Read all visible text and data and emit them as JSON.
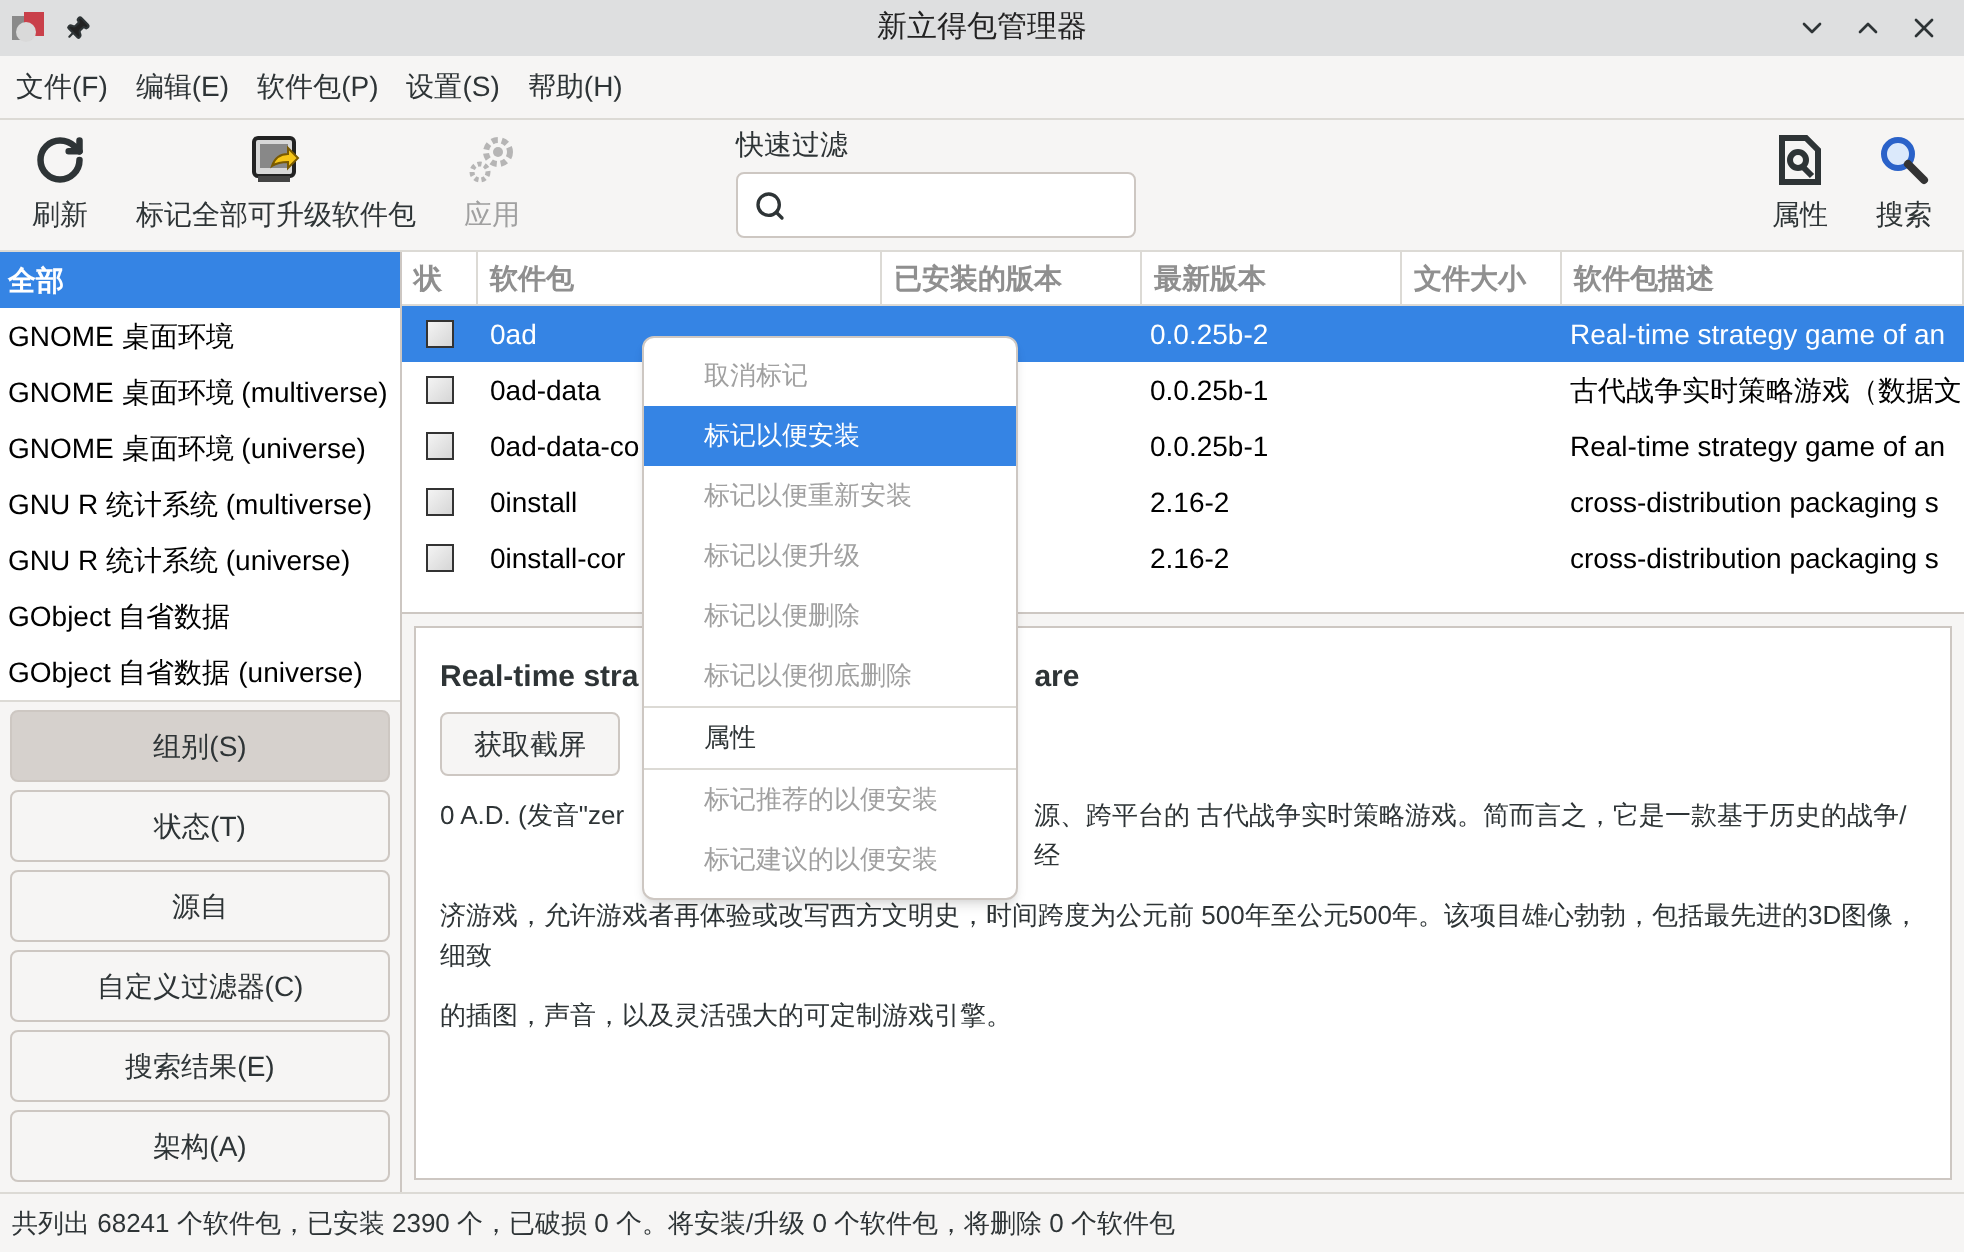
{
  "window": {
    "title": "新立得包管理器"
  },
  "menubar": [
    "文件(F)",
    "编辑(E)",
    "软件包(P)",
    "设置(S)",
    "帮助(H)"
  ],
  "toolbar": [
    {
      "kind": "refresh",
      "label": "刷新",
      "disabled": false
    },
    {
      "kind": "mark_all",
      "label": "标记全部可升级软件包",
      "disabled": false
    },
    {
      "kind": "apply",
      "label": "应用",
      "disabled": true
    }
  ],
  "quick_filter": {
    "label": "快速过滤"
  },
  "toolbar_right": [
    {
      "kind": "properties",
      "label": "属性"
    },
    {
      "kind": "search",
      "label": "搜索"
    }
  ],
  "sidebar": {
    "items": [
      {
        "label": "全部",
        "selected": true
      },
      {
        "label": "GNOME 桌面环境",
        "selected": false
      },
      {
        "label": "GNOME 桌面环境 (multiverse)",
        "selected": false
      },
      {
        "label": "GNOME 桌面环境 (universe)",
        "selected": false
      },
      {
        "label": "GNU R 统计系统 (multiverse)",
        "selected": false
      },
      {
        "label": "GNU R 统计系统 (universe)",
        "selected": false
      },
      {
        "label": "GObject 自省数据",
        "selected": false
      },
      {
        "label": "GObject 自省数据 (universe)",
        "selected": false
      }
    ],
    "buttons": [
      {
        "label": "组别(S)",
        "selected": true
      },
      {
        "label": "状态(T)",
        "selected": false
      },
      {
        "label": "源自",
        "selected": false
      },
      {
        "label": "自定义过滤器(C)",
        "selected": false
      },
      {
        "label": "搜索结果(E)",
        "selected": false
      },
      {
        "label": "架构(A)",
        "selected": false
      }
    ]
  },
  "table": {
    "columns": [
      "状",
      "软件包",
      "已安装的版本",
      "最新版本",
      "文件大小",
      "软件包描述"
    ],
    "rows": [
      {
        "checked": false,
        "selected": true,
        "name": "0ad",
        "latest": "0.0.25b-2",
        "description": "Real-time strategy game of an"
      },
      {
        "checked": false,
        "selected": false,
        "name": "0ad-data",
        "latest": "0.0.25b-1",
        "description": "古代战争实时策略游戏（数据文"
      },
      {
        "checked": false,
        "selected": false,
        "name": "0ad-data-co",
        "latest": "0.0.25b-1",
        "description": "Real-time strategy game of an"
      },
      {
        "checked": false,
        "selected": false,
        "name": "0install",
        "latest": "2.16-2",
        "description": "cross-distribution packaging s"
      },
      {
        "checked": false,
        "selected": false,
        "name": "0install-cor",
        "latest": "2.16-2",
        "description": "cross-distribution packaging s"
      }
    ]
  },
  "details": {
    "title_parts": [
      "Real-time stra",
      "are"
    ],
    "buttons": [
      "获取截屏"
    ],
    "paragraphs": [
      {
        "parts": [
          "0 A.D. (发音\"zer",
          "源、跨平台的 古代战争实时策略游戏。简而言之，它是一款基于历史的战争/经"
        ]
      },
      {
        "parts": [
          "济游戏，允许游戏者再体验或改写西方文明史，时间跨度为公元前 500年至公元500年。该项目雄心勃勃，包括最先进的3D图像，细致"
        ]
      },
      {
        "parts": [
          "的插图，声音，以及灵活强大的可定制游戏引擎。"
        ]
      }
    ]
  },
  "context_menu": [
    {
      "kind": "item",
      "label": "取消标记",
      "disabled": true,
      "selected": false
    },
    {
      "kind": "item",
      "label": "标记以便安装",
      "disabled": false,
      "selected": true
    },
    {
      "kind": "item",
      "label": "标记以便重新安装",
      "disabled": true,
      "selected": false
    },
    {
      "kind": "item",
      "label": "标记以便升级",
      "disabled": true,
      "selected": false
    },
    {
      "kind": "item",
      "label": "标记以便删除",
      "disabled": true,
      "selected": false
    },
    {
      "kind": "item",
      "label": "标记以便彻底删除",
      "disabled": true,
      "selected": false
    },
    {
      "kind": "separator"
    },
    {
      "kind": "item",
      "label": "属性",
      "disabled": false,
      "selected": false
    },
    {
      "kind": "separator"
    },
    {
      "kind": "item",
      "label": "标记推荐的以便安装",
      "disabled": true,
      "selected": false
    },
    {
      "kind": "item",
      "label": "标记建议的以便安装",
      "disabled": true,
      "selected": false
    }
  ],
  "status_bar": "共列出 68241 个软件包，已安装 2390 个，已破损 0 个。将安装/升级 0 个软件包，将删除 0 个软件包"
}
